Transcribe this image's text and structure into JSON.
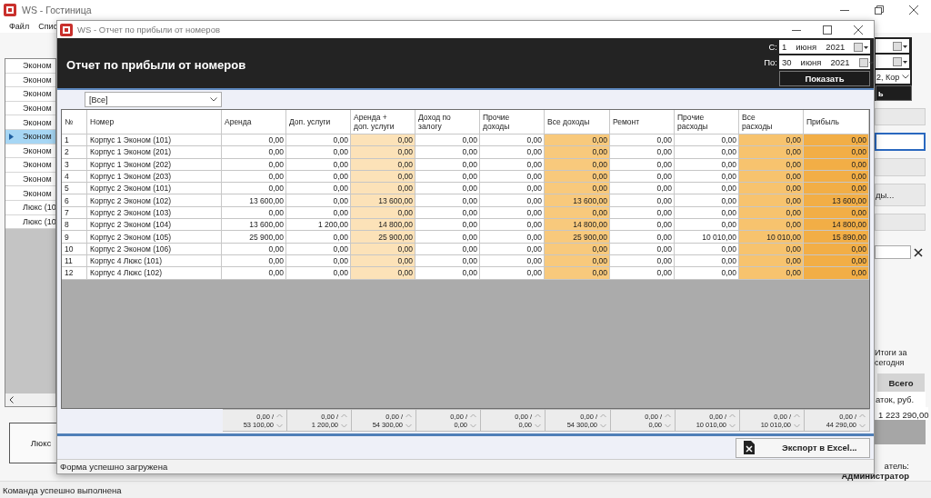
{
  "window": {
    "title": "WS - Гостиница"
  },
  "menu": [
    "Файл",
    "Спис"
  ],
  "room_list": {
    "items": [
      {
        "label": "Эконом",
        "selected": false
      },
      {
        "label": "Эконом",
        "selected": false
      },
      {
        "label": "Эконом",
        "selected": false
      },
      {
        "label": "Эконом",
        "selected": false
      },
      {
        "label": "Эконом",
        "selected": false
      },
      {
        "label": "Эконом",
        "selected": true
      },
      {
        "label": "Эконом",
        "selected": false
      },
      {
        "label": "Эконом",
        "selected": false
      },
      {
        "label": "Эконом",
        "selected": false
      },
      {
        "label": "Эконом",
        "selected": false
      },
      {
        "label": "Люкс (10",
        "selected": false
      },
      {
        "label": "Люкс (10",
        "selected": false
      }
    ]
  },
  "room_button": "Люкс",
  "right_panel": {
    "combo": "2, Кор",
    "dark_button": "ь",
    "buttons": [
      {
        "selected": false
      },
      {
        "selected": true
      },
      {
        "selected": false
      },
      {
        "label": "ды...",
        "selected": false
      },
      {
        "selected": false
      }
    ],
    "summary_label": "Итоги за сегодня",
    "tab": "Всего",
    "table_header": "аток, руб.",
    "table_value": "1 223 290,00",
    "user_label": "атель:",
    "user": "Администратор"
  },
  "status_bar": "Команда успешно выполнена",
  "report": {
    "title": "WS - Отчет по прибыли от номеров",
    "heading": "Отчет по прибыли от номеров",
    "from_label": "С:",
    "from": {
      "day": "1",
      "month": "июня",
      "year": "2021"
    },
    "to_label": "По:",
    "to": {
      "day": "30",
      "month": "июня",
      "year": "2021"
    },
    "show_button": "Показать",
    "filter": "[Все]",
    "columns": [
      {
        "label": "№",
        "kind": "index"
      },
      {
        "label": "Номер",
        "kind": "text"
      },
      {
        "label": "Аренда",
        "kind": "value"
      },
      {
        "label": "Доп. услуги",
        "kind": "value"
      },
      {
        "label": "Аренда +\nдоп. услуги",
        "kind": "subtotal"
      },
      {
        "label": "Доход по\nзалогу",
        "kind": "value"
      },
      {
        "label": "Прочие\nдоходы",
        "kind": "value"
      },
      {
        "label": "Все доходы",
        "kind": "income"
      },
      {
        "label": "Ремонт",
        "kind": "value"
      },
      {
        "label": "Прочие\nрасходы",
        "kind": "value"
      },
      {
        "label": "Все\nрасходы",
        "kind": "expense"
      },
      {
        "label": "Прибыль",
        "kind": "profit"
      }
    ],
    "rows": [
      [
        "1",
        "Корпус 1 Эконом (101)",
        "0,00",
        "0,00",
        "0,00",
        "0,00",
        "0,00",
        "0,00",
        "0,00",
        "0,00",
        "0,00",
        "0,00"
      ],
      [
        "2",
        "Корпус 1 Эконом (201)",
        "0,00",
        "0,00",
        "0,00",
        "0,00",
        "0,00",
        "0,00",
        "0,00",
        "0,00",
        "0,00",
        "0,00"
      ],
      [
        "3",
        "Корпус 1 Эконом (202)",
        "0,00",
        "0,00",
        "0,00",
        "0,00",
        "0,00",
        "0,00",
        "0,00",
        "0,00",
        "0,00",
        "0,00"
      ],
      [
        "4",
        "Корпус 1 Эконом (203)",
        "0,00",
        "0,00",
        "0,00",
        "0,00",
        "0,00",
        "0,00",
        "0,00",
        "0,00",
        "0,00",
        "0,00"
      ],
      [
        "5",
        "Корпус 2 Эконом (101)",
        "0,00",
        "0,00",
        "0,00",
        "0,00",
        "0,00",
        "0,00",
        "0,00",
        "0,00",
        "0,00",
        "0,00"
      ],
      [
        "6",
        "Корпус 2 Эконом (102)",
        "13 600,00",
        "0,00",
        "13 600,00",
        "0,00",
        "0,00",
        "13 600,00",
        "0,00",
        "0,00",
        "0,00",
        "13 600,00"
      ],
      [
        "7",
        "Корпус 2 Эконом (103)",
        "0,00",
        "0,00",
        "0,00",
        "0,00",
        "0,00",
        "0,00",
        "0,00",
        "0,00",
        "0,00",
        "0,00"
      ],
      [
        "8",
        "Корпус 2 Эконом (104)",
        "13 600,00",
        "1 200,00",
        "14 800,00",
        "0,00",
        "0,00",
        "14 800,00",
        "0,00",
        "0,00",
        "0,00",
        "14 800,00"
      ],
      [
        "9",
        "Корпус 2 Эконом (105)",
        "25 900,00",
        "0,00",
        "25 900,00",
        "0,00",
        "0,00",
        "25 900,00",
        "0,00",
        "10 010,00",
        "10 010,00",
        "15 890,00"
      ],
      [
        "10",
        "Корпус 2 Эконом (106)",
        "0,00",
        "0,00",
        "0,00",
        "0,00",
        "0,00",
        "0,00",
        "0,00",
        "0,00",
        "0,00",
        "0,00"
      ],
      [
        "11",
        "Корпус 4 Люкс (101)",
        "0,00",
        "0,00",
        "0,00",
        "0,00",
        "0,00",
        "0,00",
        "0,00",
        "0,00",
        "0,00",
        "0,00"
      ],
      [
        "12",
        "Корпус 4 Люкс (102)",
        "0,00",
        "0,00",
        "0,00",
        "0,00",
        "0,00",
        "0,00",
        "0,00",
        "0,00",
        "0,00",
        "0,00"
      ]
    ],
    "totals": [
      {
        "current": "0,00 /",
        "total": "53 100,00"
      },
      {
        "current": "0,00 /",
        "total": "1 200,00"
      },
      {
        "current": "0,00 /",
        "total": "54 300,00"
      },
      {
        "current": "0,00 /",
        "total": "0,00"
      },
      {
        "current": "0,00 /",
        "total": "0,00"
      },
      {
        "current": "0,00 /",
        "total": "54 300,00"
      },
      {
        "current": "0,00 /",
        "total": "0,00"
      },
      {
        "current": "0,00 /",
        "total": "10 010,00"
      },
      {
        "current": "0,00 /",
        "total": "10 010,00"
      },
      {
        "current": "0,00 /",
        "total": "44 290,00"
      }
    ],
    "export_button": "Экспорт в Excel...",
    "status": "Форма успешно загружена"
  }
}
